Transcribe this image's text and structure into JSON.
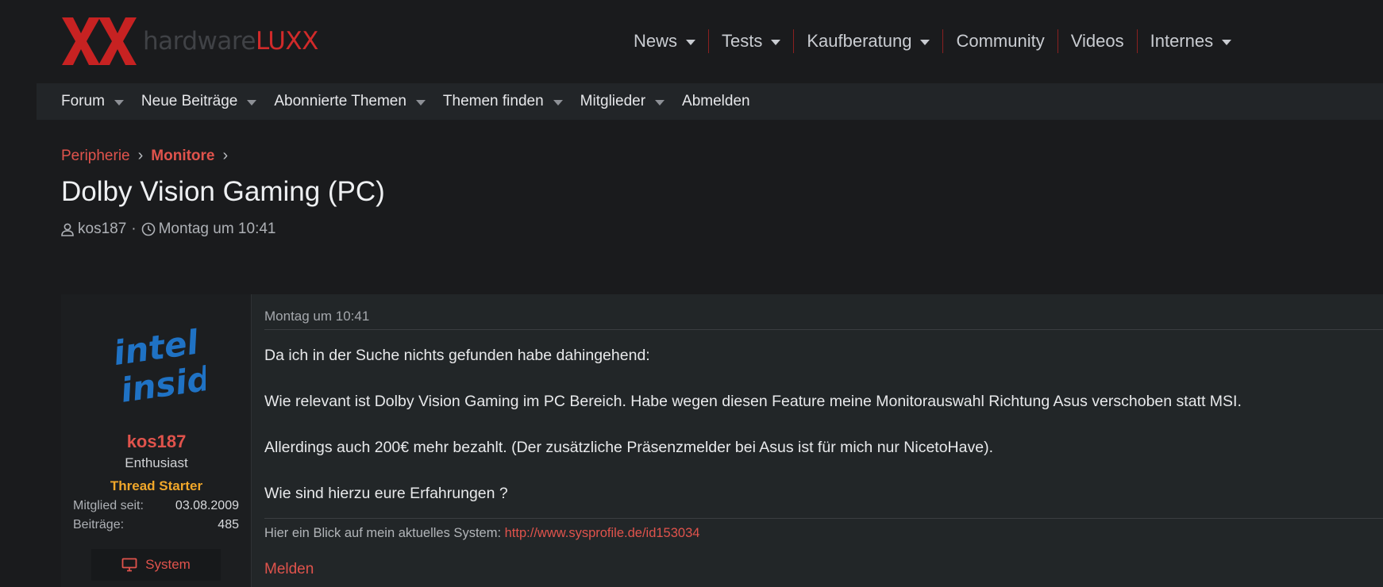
{
  "logo": {
    "text_part1": "hardware",
    "text_part2": "LUXX"
  },
  "main_nav": [
    {
      "label": "News",
      "dropdown": true
    },
    {
      "label": "Tests",
      "dropdown": true
    },
    {
      "label": "Kaufberatung",
      "dropdown": true
    },
    {
      "label": "Community",
      "dropdown": false
    },
    {
      "label": "Videos",
      "dropdown": false
    },
    {
      "label": "Internes",
      "dropdown": true
    }
  ],
  "sub_nav": [
    {
      "label": "Forum",
      "dropdown": true
    },
    {
      "label": "Neue Beiträge",
      "dropdown": true
    },
    {
      "label": "Abonnierte Themen",
      "dropdown": true
    },
    {
      "label": "Themen finden",
      "dropdown": true
    },
    {
      "label": "Mitglieder",
      "dropdown": true
    },
    {
      "label": "Abmelden",
      "dropdown": false
    }
  ],
  "breadcrumb": [
    {
      "label": "Peripherie"
    },
    {
      "label": "Monitore"
    }
  ],
  "thread": {
    "title": "Dolby Vision Gaming (PC)",
    "author": "kos187",
    "date": "Montag um 10:41"
  },
  "post": {
    "user": {
      "avatar_text_line1": "intel",
      "avatar_text_line2": "inside",
      "name": "kos187",
      "title": "Enthusiast",
      "badge": "Thread Starter",
      "stats": [
        {
          "label": "Mitglied seit:",
          "value": "03.08.2009"
        },
        {
          "label": "Beiträge:",
          "value": "485"
        }
      ],
      "system_button": "System"
    },
    "timestamp": "Montag um 10:41",
    "paragraphs": [
      "Da ich in der Suche nichts gefunden habe dahingehend:",
      "Wie relevant ist Dolby Vision Gaming im PC Bereich. Habe wegen diesen Feature meine Monitorauswahl Richtung Asus verschoben statt MSI.",
      "Allerdings auch 200€ mehr bezahlt. (Der zusätzliche Präsenzmelder bei Asus ist für mich nur NicetoHave).",
      "Wie sind hierzu eure Erfahrungen ?"
    ],
    "signature_text": "Hier ein Blick auf mein aktuelles System:",
    "signature_link": "http://www.sysprofile.de/id153034",
    "report_label": "Melden"
  },
  "colors": {
    "accent_red": "#e0534c",
    "logo_red": "#d12a2a",
    "starter_orange": "#f0a72a",
    "intel_blue": "#1f72c4"
  }
}
